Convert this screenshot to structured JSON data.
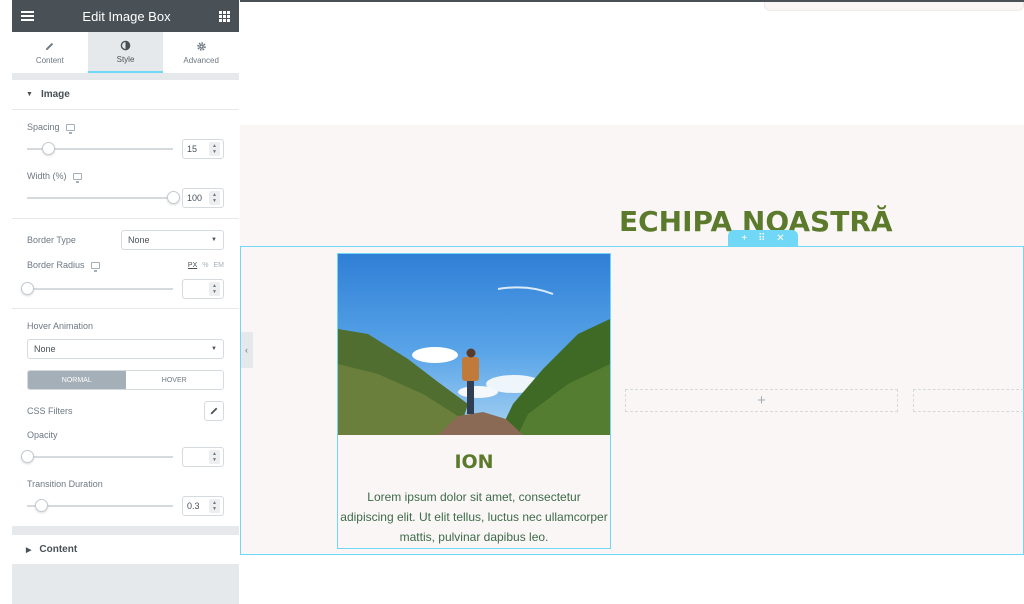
{
  "panel": {
    "title": "Edit Image Box",
    "tabs": [
      {
        "label": "Content",
        "icon": "pencil-icon"
      },
      {
        "label": "Style",
        "icon": "contrast-icon"
      },
      {
        "label": "Advanced",
        "icon": "gear-icon"
      }
    ],
    "active_tab": "Style",
    "image_section": {
      "title": "Image",
      "spacing": {
        "label": "Spacing",
        "value": "15",
        "slider_fraction": 0.15
      },
      "width": {
        "label": "Width (%)",
        "value": "100",
        "slider_fraction": 1.0
      },
      "border_type": {
        "label": "Border Type",
        "value": "None"
      },
      "border_radius": {
        "label": "Border Radius",
        "value": "",
        "units": [
          "PX",
          "%",
          "EM"
        ],
        "active_unit": "PX",
        "slider_fraction": 0.0
      },
      "hover_animation": {
        "label": "Hover Animation",
        "value": "None"
      },
      "state_tabs": {
        "normal": "NORMAL",
        "hover": "HOVER",
        "active": "NORMAL"
      },
      "css_filters": {
        "label": "CSS Filters"
      },
      "opacity": {
        "label": "Opacity",
        "value": "",
        "slider_fraction": 0.0
      },
      "transition_duration": {
        "label": "Transition Duration",
        "value": "0.3",
        "slider_fraction": 0.1
      }
    },
    "content_section": {
      "title": "Content"
    }
  },
  "canvas": {
    "heading": "ECHIPA NOASTRĂ",
    "card": {
      "name": "ION",
      "text": "Lorem ipsum dolor sit amet, consectetur adipiscing elit. Ut elit tellus, luctus nec ullamcorper mattis, pulvinar dapibus leo."
    },
    "section_handle": {
      "add": "+",
      "move": "⠿",
      "close": "✕"
    },
    "empty_column_add": "+"
  },
  "colors": {
    "panel_header": "#495157",
    "accent": "#71d7f7",
    "heading_green": "#5b7a2c",
    "text_green": "#3d6a4a",
    "section_bg": "#faf6f5"
  }
}
